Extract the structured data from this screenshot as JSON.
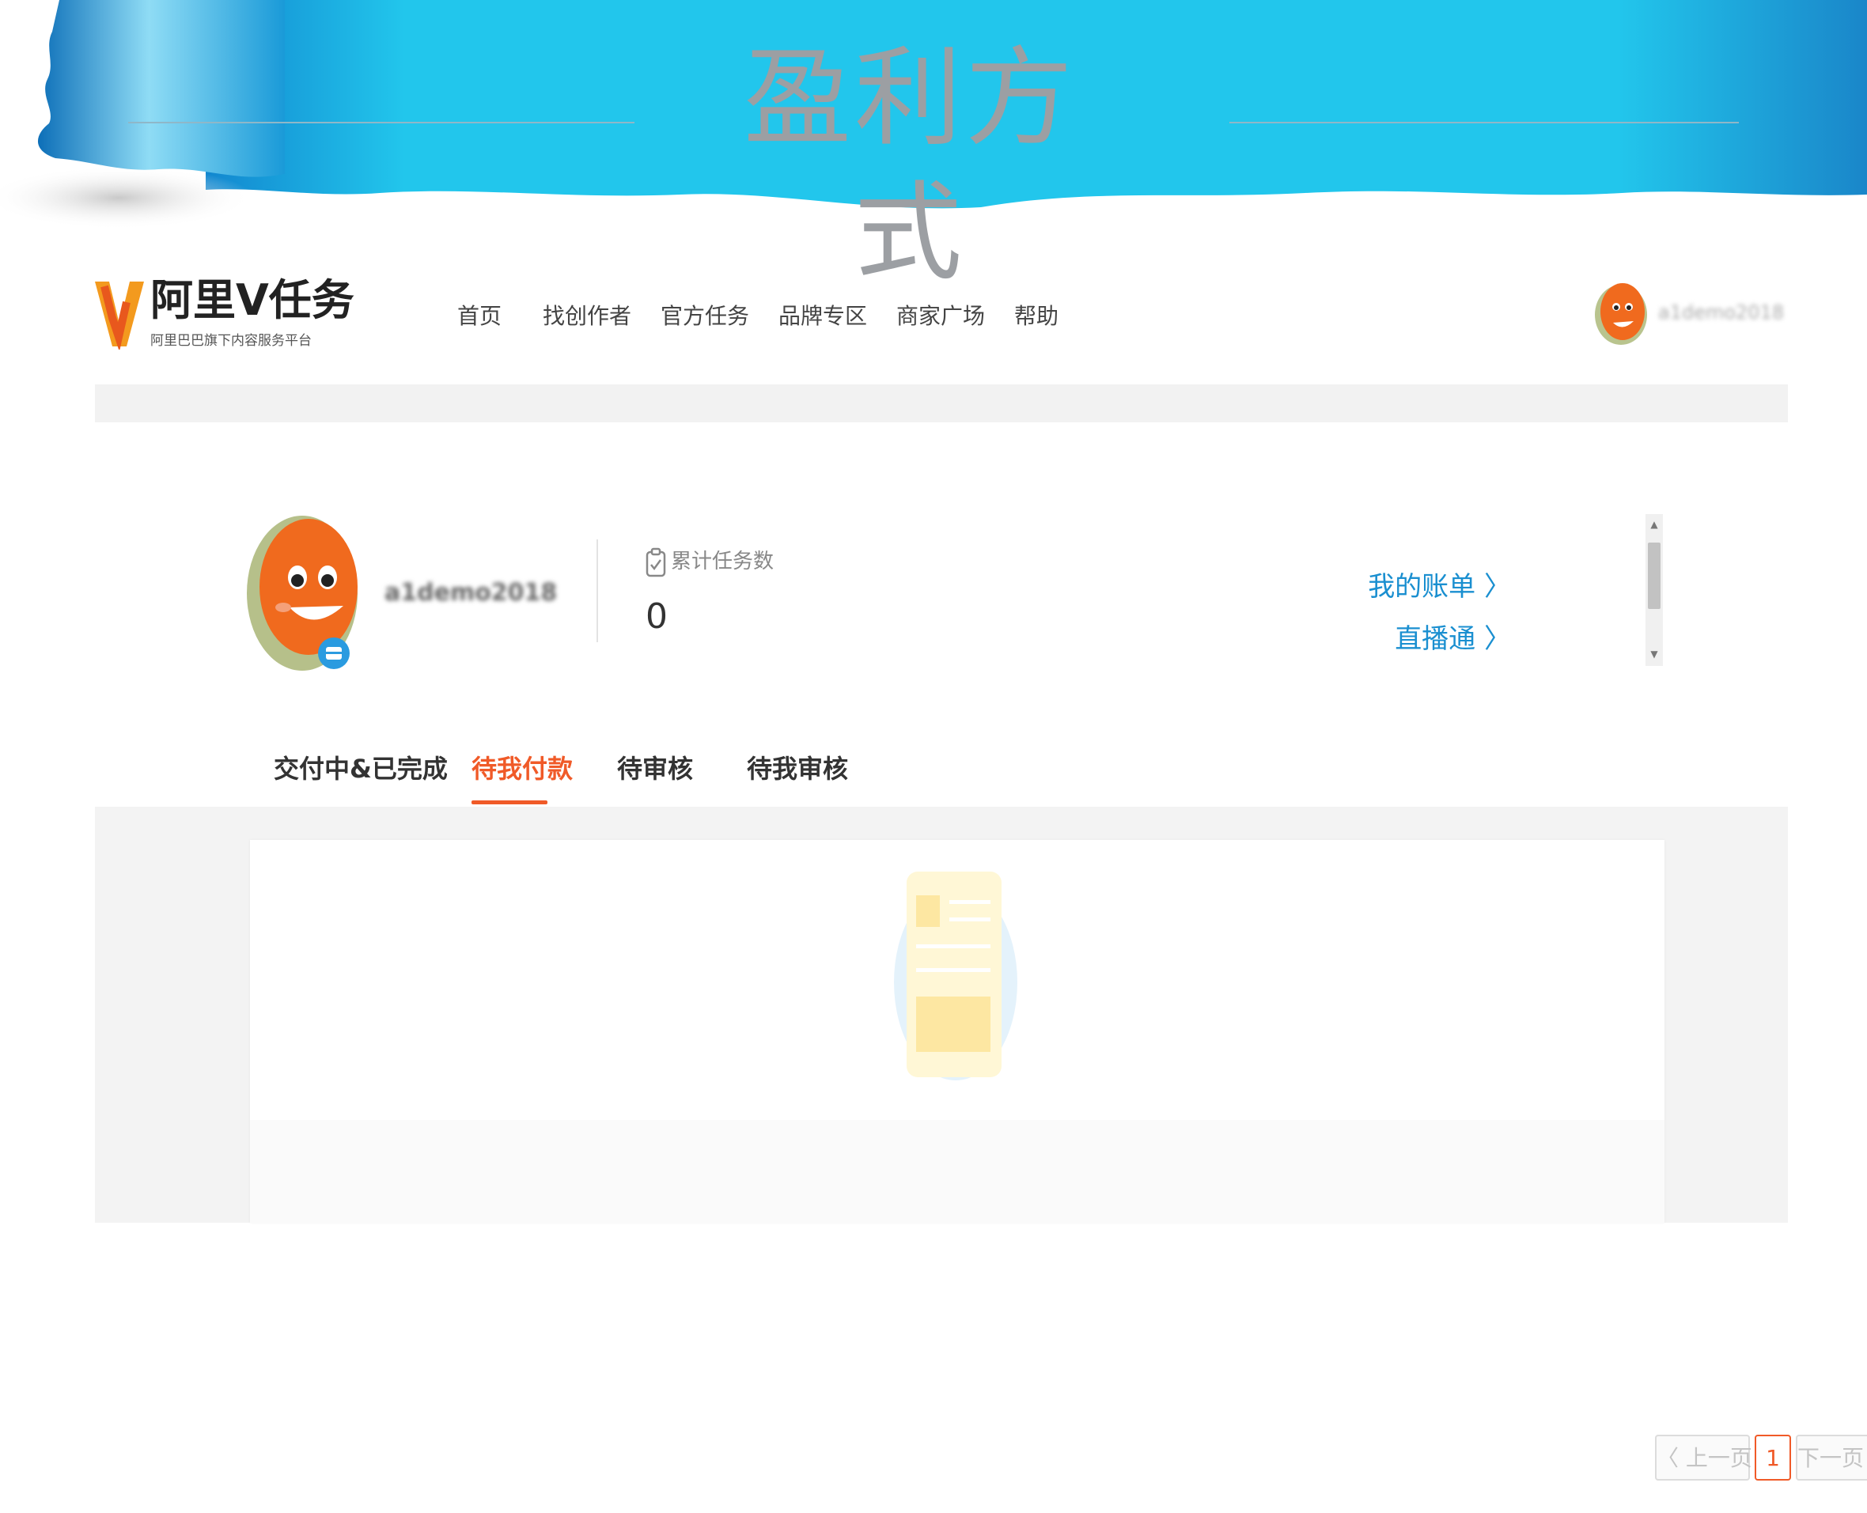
{
  "banner": {
    "title": "盈利方式"
  },
  "nav": {
    "logo_name": "阿里V任务",
    "logo_tagline": "阿里巴巴旗下内容服务平台",
    "links": [
      "首页",
      "找创作者",
      "官方任务",
      "品牌专区",
      "商家广场",
      "帮助"
    ],
    "username_blurred": "a1demo2018"
  },
  "profile": {
    "username_blurred": "a1demo2018",
    "stat_label": "累计任务数",
    "stat_value": "0",
    "link_bill": "我的账单 〉",
    "link_live": "直播通 〉"
  },
  "tabs": {
    "items": [
      "交付中&已完成",
      "待我付款",
      "待审核",
      "待我审核"
    ],
    "active_index": 1
  },
  "pagination": {
    "prev": "〈 上一页",
    "current": "1",
    "next": "下一页 〉"
  },
  "colors": {
    "accent": "#f05a28",
    "link": "#1a8fd0",
    "banner_blue": "#22c6ec"
  }
}
